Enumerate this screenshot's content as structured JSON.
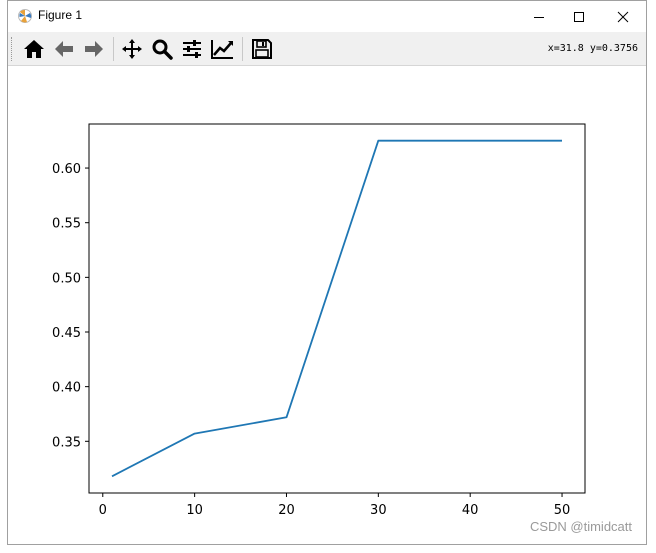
{
  "window": {
    "title": "Figure 1",
    "controls": [
      "minimize-icon",
      "maximize-icon",
      "close-icon"
    ]
  },
  "toolbar": {
    "buttons": [
      {
        "icon": "home-icon"
      },
      {
        "icon": "back-arrow-icon"
      },
      {
        "icon": "forward-arrow-icon"
      },
      {
        "icon": "pan-icon"
      },
      {
        "icon": "zoom-icon"
      },
      {
        "icon": "configure-subplots-icon"
      },
      {
        "icon": "edit-axis-icon"
      },
      {
        "icon": "save-icon"
      }
    ],
    "coordinates": "x=31.8 y=0.3756"
  },
  "chart_data": {
    "type": "line",
    "x": [
      1,
      10,
      20,
      30,
      40,
      50
    ],
    "series": [
      {
        "values": [
          0.318,
          0.357,
          0.372,
          0.625,
          0.625,
          0.625
        ],
        "color": "#1f77b4"
      }
    ],
    "xticks": [
      "0",
      "10",
      "20",
      "30",
      "40",
      "50"
    ],
    "yticks": [
      "0.35",
      "0.40",
      "0.45",
      "0.50",
      "0.55",
      "0.60"
    ],
    "xlim": [
      -1.5,
      52.5
    ],
    "ylim": [
      0.3027,
      0.6403
    ],
    "grid": false,
    "title": "",
    "xlabel": "",
    "ylabel": ""
  },
  "watermark": "CSDN @timidcatt"
}
